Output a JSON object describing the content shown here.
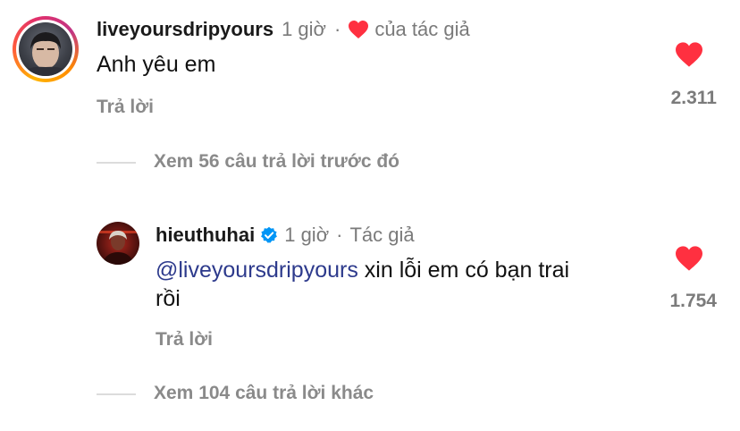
{
  "comment": {
    "username": "liveyoursdripyours",
    "time": "1 giờ",
    "dot": "·",
    "author_liked_label": "của tác giả",
    "text": "Anh yêu em",
    "reply_label": "Trả lời",
    "likes": "2.311"
  },
  "view_previous": "Xem 56 câu trả lời trước đó",
  "reply": {
    "username": "hieuthuhai",
    "verified": true,
    "time": "1 giờ",
    "dot": "·",
    "author_tag": "Tác giả",
    "mention": "@liveyoursdripyours",
    "text_line1": " xin lỗi em có bạn trai",
    "text_line2": "rồi",
    "reply_label": "Trả lời",
    "likes": "1.754"
  },
  "view_more": "Xem 104 câu trả lời khác",
  "colors": {
    "heart": "#ff3040",
    "verified": "#0095f6",
    "mention": "#2d3a8c"
  },
  "icons": [
    "heart-icon",
    "verified-badge-icon"
  ]
}
